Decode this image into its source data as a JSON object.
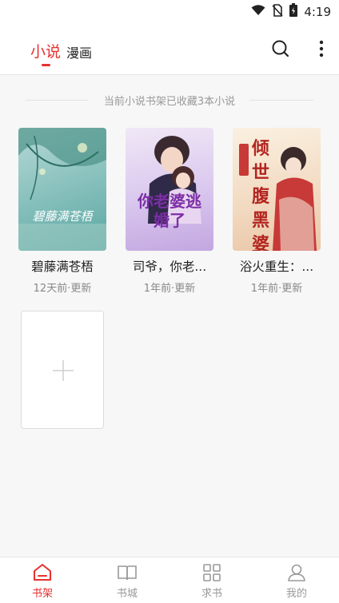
{
  "status_bar": {
    "time": "4:19",
    "icons": [
      "wifi-icon",
      "no-sim-icon",
      "battery-icon"
    ]
  },
  "header": {
    "tabs": [
      {
        "label": "小说",
        "active": true
      },
      {
        "label": "漫画",
        "active": false
      }
    ],
    "icons": [
      "search-icon",
      "more-vert-icon"
    ]
  },
  "shelf": {
    "summary": "当前小说书架已收藏3本小说",
    "books": [
      {
        "title": "碧藤满苍梧",
        "status": "12天前·更新",
        "cover_text": "碧藤满苍梧"
      },
      {
        "title": "司爷，你老...",
        "status": "1年前·更新",
        "cover_text": "你老婆逃婚了"
      },
      {
        "title": "浴火重生：...",
        "status": "1年前·更新",
        "cover_text": "倾世腹黑婆"
      }
    ],
    "add_icon": "plus-icon"
  },
  "bottom_nav": [
    {
      "label": "书架",
      "icon": "home-icon",
      "active": true
    },
    {
      "label": "书城",
      "icon": "book-open-icon",
      "active": false
    },
    {
      "label": "求书",
      "icon": "grid-icon",
      "active": false
    },
    {
      "label": "我的",
      "icon": "user-icon",
      "active": false
    }
  ],
  "colors": {
    "accent": "#e6312f",
    "muted": "#999999",
    "background": "#f7f7f7"
  }
}
